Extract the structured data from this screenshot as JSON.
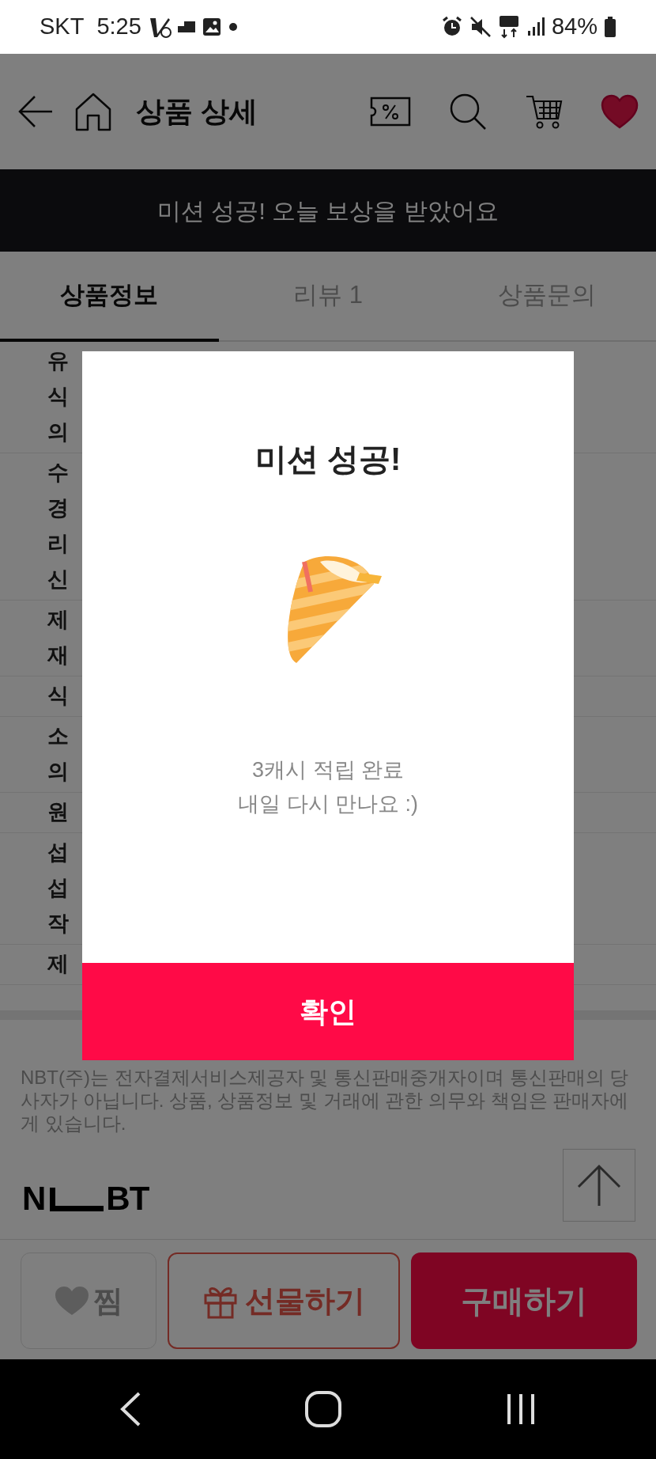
{
  "status_bar": {
    "carrier": "SKT",
    "time": "5:25",
    "battery": "84%"
  },
  "header": {
    "title": "상품 상세",
    "favorite": true
  },
  "banner": "미션 성공! 오늘 보상을 받았어요",
  "tabs": [
    {
      "label": "상품정보",
      "selected": true
    },
    {
      "label": "리뷰 1",
      "selected": false
    },
    {
      "label": "상품문의",
      "selected": false
    }
  ],
  "info_rows": [
    {
      "lines": [
        "유",
        "식",
        "의"
      ]
    },
    {
      "lines": [
        "수",
        "경",
        "리",
        "신"
      ]
    },
    {
      "lines": [
        "제",
        "재"
      ]
    },
    {
      "lines": [
        "식"
      ]
    },
    {
      "lines": [
        "소",
        "의"
      ]
    },
    {
      "lines": [
        "원"
      ]
    },
    {
      "lines": [
        "섭",
        "섭",
        "작"
      ]
    },
    {
      "lines": [
        "제"
      ]
    }
  ],
  "disclaimer": "NBT(주)는 전자결제서비스제공자 및 통신판매중개자이며 통신판매의 당사자가 아닙니다. 상품, 상품정보 및 거래에 관한 의무와 책임은 판매자에게 있습니다.",
  "logo": {
    "left": "N",
    "right": "BT"
  },
  "bottom_bar": {
    "wish": {
      "label": "찜",
      "wished": false
    },
    "gift": "선물하기",
    "buy": "구매하기"
  },
  "modal": {
    "title": "미션 성공!",
    "lines": [
      "3캐시 적립 완료",
      "내일 다시 만나요 :)"
    ],
    "confirm": "확인"
  }
}
